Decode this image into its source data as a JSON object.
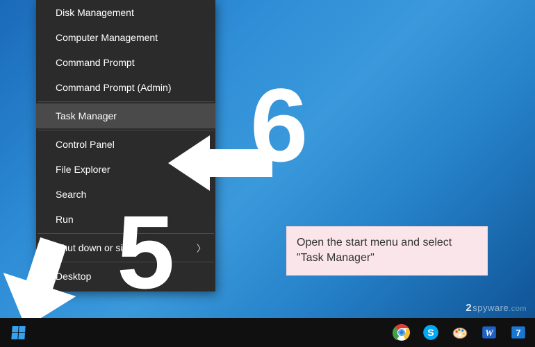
{
  "menu": {
    "items": [
      {
        "label": "Disk Management",
        "divider_after": false
      },
      {
        "label": "Computer Management",
        "divider_after": false
      },
      {
        "label": "Command Prompt",
        "divider_after": false
      },
      {
        "label": "Command Prompt (Admin)",
        "divider_after": true
      },
      {
        "label": "Task Manager",
        "highlight": true,
        "divider_after": true
      },
      {
        "label": "Control Panel",
        "divider_after": false
      },
      {
        "label": "File Explorer",
        "divider_after": false
      },
      {
        "label": "Search",
        "divider_after": false
      },
      {
        "label": "Run",
        "divider_after": true
      },
      {
        "label": "Shut down or sign out",
        "submenu": true,
        "divider_after": true
      },
      {
        "label": "Desktop",
        "divider_after": false
      }
    ]
  },
  "overlay": {
    "number_top": "6",
    "number_mid": "5",
    "info_text": "Open the start menu and select \"Task Manager\""
  },
  "watermark": {
    "two": "2",
    "mid": "spyware",
    "com": ".com"
  },
  "colors": {
    "menu_bg": "#2b2b2b",
    "highlight": "#4a4a4a",
    "info_bg": "#fae6ea",
    "win_accent": "#35a2f0"
  },
  "taskbar": {
    "icons": [
      "chrome-icon",
      "skype-icon",
      "paint-icon",
      "word-icon",
      "seven-icon"
    ]
  }
}
